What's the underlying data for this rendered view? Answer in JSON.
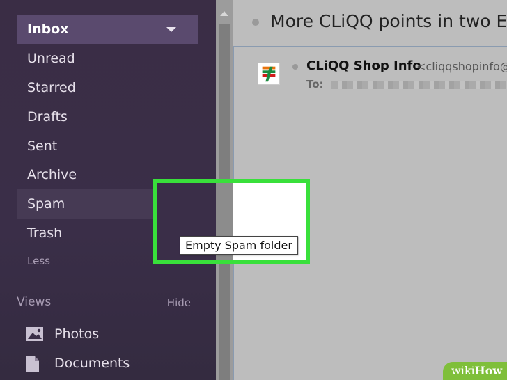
{
  "sidebar": {
    "folders": [
      {
        "label": "Inbox",
        "state": "selected"
      },
      {
        "label": "Unread"
      },
      {
        "label": "Starred"
      },
      {
        "label": "Drafts"
      },
      {
        "label": "Sent"
      },
      {
        "label": "Archive"
      },
      {
        "label": "Spam",
        "state": "hover"
      },
      {
        "label": "Trash"
      },
      {
        "label": "Less"
      }
    ],
    "views": {
      "label": "Views",
      "hide": "Hide",
      "items": [
        {
          "label": "Photos",
          "icon": "photo-icon"
        },
        {
          "label": "Documents",
          "icon": "document-icon"
        }
      ]
    }
  },
  "email": {
    "subject": "More CLiQQ points in two EAS",
    "sender": "CLiQQ Shop Info",
    "sender_email": "<cliqqshopinfo@",
    "to_label": "To:"
  },
  "tooltip": "Empty Spam folder",
  "watermark": {
    "wiki": "wiki",
    "how": "How"
  },
  "colors": {
    "sidebar": "#3a2e48",
    "highlight": "#39e03b",
    "trash": "#e05a5a",
    "selected": "#5a4a6e"
  }
}
